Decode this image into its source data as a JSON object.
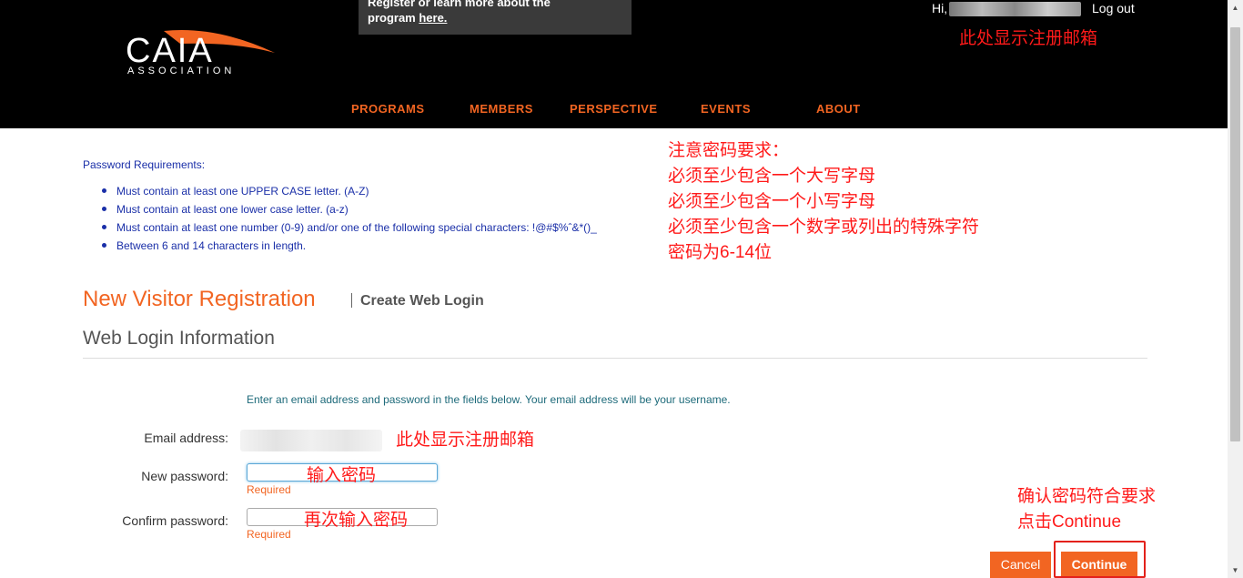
{
  "header": {
    "logo_text": "CAIA",
    "logo_subtext": "ASSOCIATION",
    "promo": {
      "line1": "Register or learn more about the",
      "line2_prefix": "program ",
      "link": "here."
    },
    "user": {
      "greeting": "Hi,",
      "logout": "Log out"
    },
    "annotation": "此处显示注册邮箱",
    "nav": [
      "PROGRAMS",
      "MEMBERS",
      "PERSPECTIVE",
      "EVENTS",
      "ABOUT"
    ]
  },
  "requirements": {
    "title": "Password Requirements:",
    "items": [
      "Must contain at least one UPPER CASE letter. (A-Z)",
      "Must contain at least one lower case letter. (a-z)",
      "Must contain at least one number (0-9) and/or one of the following special characters: !@#$%ˆ&*()_",
      "Between 6 and 14 characters in length."
    ],
    "annotation_lines": [
      "注意密码要求：",
      "必须至少包含一个大写字母",
      "必须至少包含一个小写字母",
      "必须至少包含一个数字或列出的特殊字符",
      "密码为6-14位"
    ]
  },
  "form": {
    "title": "New Visitor Registration",
    "subtitle": "Create Web Login",
    "section": "Web Login Information",
    "instructions": "Enter an email address and password in the fields below. Your email address will be your username.",
    "email_label": "Email address:",
    "email_annotation": "此处显示注册邮箱",
    "new_password_label": "New password:",
    "new_password_annotation": "输入密码",
    "new_password_value": "",
    "confirm_password_label": "Confirm password:",
    "confirm_password_annotation": "再次输入密码",
    "confirm_password_value": "",
    "required": "Required",
    "confirm_annotation_lines": [
      "确认密码符合要求",
      "点击Continue"
    ],
    "cancel": "Cancel",
    "continue": "Continue"
  },
  "colors": {
    "accent": "#f26522",
    "annotation": "#ff1a1a",
    "link_blue": "#1a2fa8",
    "header_bg": "#000000"
  }
}
